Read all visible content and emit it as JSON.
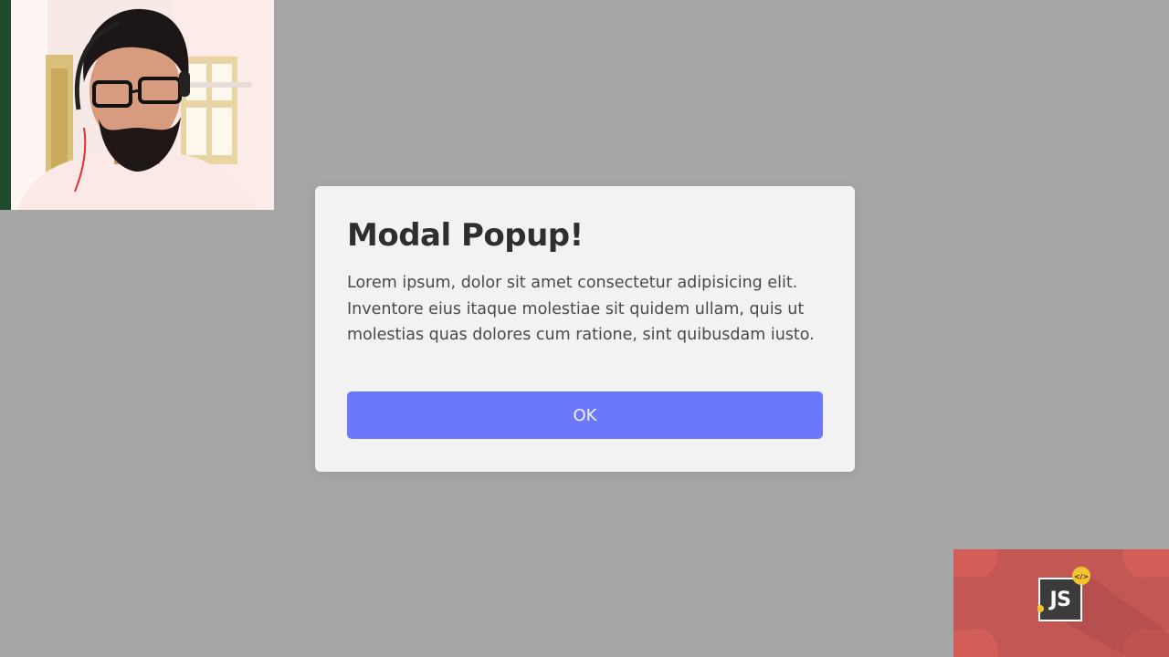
{
  "modal": {
    "title": "Modal Popup!",
    "body": "Lorem ipsum, dolor sit amet consectetur adipisicing elit. Inventore eius itaque molestiae sit quidem ullam, quis ut molestias quas dolores cum ratione, sint quibusdam iusto.",
    "ok_label": "OK"
  },
  "brand": {
    "logo_text": "JS",
    "code_icon_text": "</>"
  },
  "colors": {
    "page_background": "#a6a6a6",
    "modal_background": "#f2f2f2",
    "accent": "#6b78fb",
    "brand_background": "#d35d57"
  },
  "icons": {
    "logo": "js-logo-icon",
    "code": "code-icon"
  }
}
